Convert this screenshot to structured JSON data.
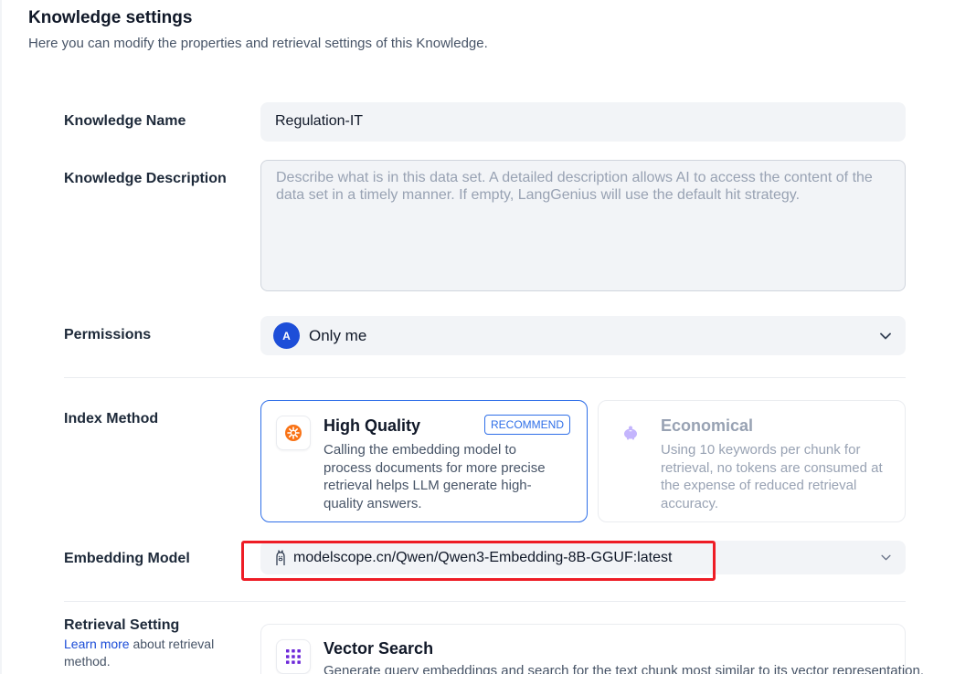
{
  "header": {
    "title": "Knowledge settings",
    "subtitle": "Here you can modify the properties and retrieval settings of this Knowledge."
  },
  "name_field": {
    "label": "Knowledge Name",
    "value": "Regulation-IT"
  },
  "description_field": {
    "label": "Knowledge Description",
    "placeholder": "Describe what is in this data set. A detailed description allows AI to access the content of the data set in a timely manner. If empty, LangGenius will use the default hit strategy."
  },
  "permissions": {
    "label": "Permissions",
    "avatar_letter": "A",
    "value": "Only me"
  },
  "index_method": {
    "label": "Index Method",
    "options": [
      {
        "title": "High Quality",
        "badge": "RECOMMEND",
        "description": "Calling the embedding model to process documents for more precise retrieval helps LLM generate high-quality answers.",
        "icon": "star-badge-icon",
        "selected": true
      },
      {
        "title": "Economical",
        "description": "Using 10 keywords per chunk for retrieval, no tokens are consumed at the expense of reduced retrieval accuracy.",
        "icon": "piggy-bank-icon",
        "selected": false
      }
    ]
  },
  "embedding_model": {
    "label": "Embedding Model",
    "value": "modelscope.cn/Qwen/Qwen3-Embedding-8B-GGUF:latest",
    "icon": "llama-icon"
  },
  "retrieval_setting": {
    "label": "Retrieval Setting",
    "learn_more_link": "Learn more",
    "learn_more_suffix": " about retrieval method.",
    "vector_search": {
      "title": "Vector Search",
      "description": "Generate query embeddings and search for the text chunk most similar to its vector representation."
    }
  },
  "colors": {
    "accent": "#2f6fe8",
    "highlight_box": "#ee1c25",
    "field_bg": "#f2f4f7"
  }
}
